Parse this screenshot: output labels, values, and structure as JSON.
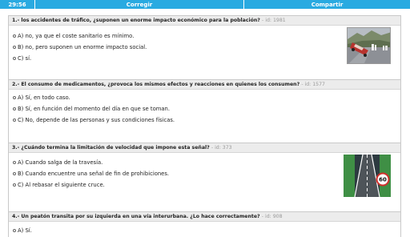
{
  "toolbar": {
    "timer": "29:56",
    "check_label": "Corregir",
    "share_label": "Compartir"
  },
  "questions": [
    {
      "title": "1.- los accidentes de tráfico, ¿suponen un enorme impacto económico para la población?",
      "id_label": "- id: 1981",
      "answers": [
        "A) no, ya que el coste sanitario es mínimo.",
        "B) no, pero suponen un enorme impacto social.",
        "C) sí."
      ],
      "image": "car-accident-photo"
    },
    {
      "title": "2.- El consumo de medicamentos, ¿provoca los mismos efectos y reacciones en quienes los consumen?",
      "id_label": "- id: 1577",
      "answers": [
        "A) Sí, en todo caso.",
        "B) Sí, en función del momento del día en que se toman.",
        "C) No, depende de las personas y sus condiciones físicas."
      ]
    },
    {
      "title": "3.- ¿Cuándo termina la limitación de velocidad que impone esta señal?",
      "id_label": "- id: 373",
      "answers": [
        "A) Cuando salga de la travesía.",
        "B) Cuando encuentre una señal de fin de prohibiciones.",
        "C) Al rebasar el siguiente cruce."
      ],
      "image": "road-speed-limit-sign",
      "sign_value": "60"
    },
    {
      "title": "4.- Un peatón transita por su izquierda en una vía interurbana. ¿Lo hace correctamente?",
      "id_label": "- id: 908",
      "answers": [
        "A) Sí."
      ]
    }
  ]
}
